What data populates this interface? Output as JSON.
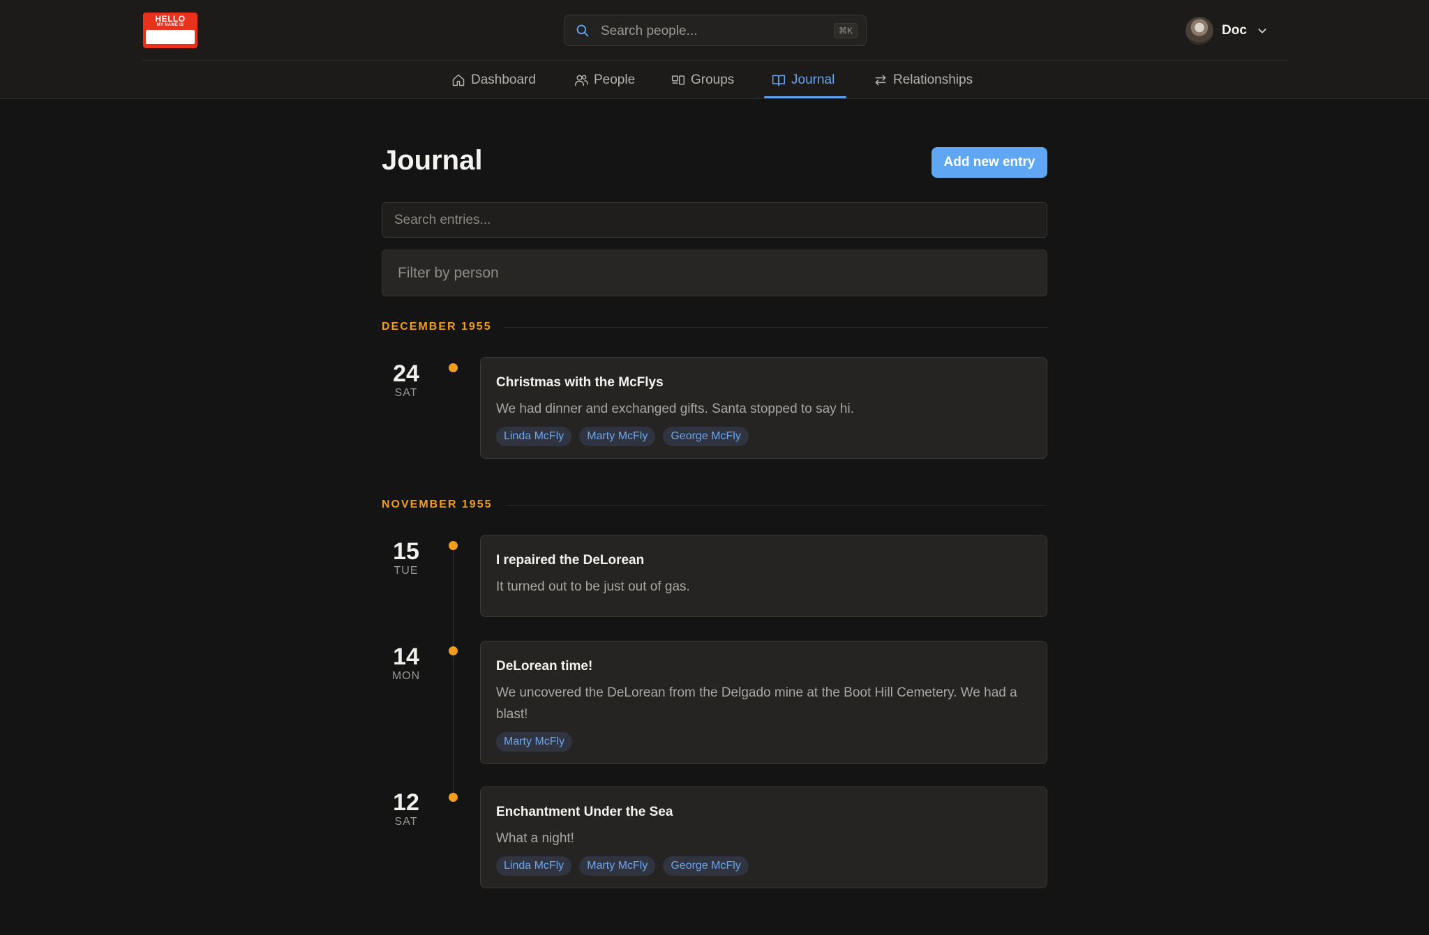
{
  "header": {
    "logo": {
      "line1": "HELLO",
      "line2": "MY NAME IS"
    },
    "search": {
      "placeholder": "Search people...",
      "shortcut": "⌘K"
    },
    "user": {
      "name": "Doc"
    }
  },
  "nav": {
    "items": [
      {
        "label": "Dashboard",
        "icon": "home-icon",
        "active": false
      },
      {
        "label": "People",
        "icon": "users-icon",
        "active": false
      },
      {
        "label": "Groups",
        "icon": "groups-icon",
        "active": false
      },
      {
        "label": "Journal",
        "icon": "book-icon",
        "active": true
      },
      {
        "label": "Relationships",
        "icon": "arrows-swap-icon",
        "active": false
      }
    ]
  },
  "page": {
    "title": "Journal",
    "add_button": "Add new entry",
    "search_placeholder": "Search entries...",
    "filter_placeholder": "Filter by person"
  },
  "months": [
    {
      "label": "DECEMBER 1955",
      "entries": [
        {
          "day": "24",
          "dow": "SAT",
          "title": "Christmas with the McFlys",
          "body": "We had dinner and exchanged gifts. Santa stopped to say hi.",
          "tags": [
            "Linda McFly",
            "Marty McFly",
            "George McFly"
          ]
        }
      ]
    },
    {
      "label": "NOVEMBER 1955",
      "entries": [
        {
          "day": "15",
          "dow": "TUE",
          "title": "I repaired the DeLorean",
          "body": "It turned out to be just out of gas.",
          "tags": []
        },
        {
          "day": "14",
          "dow": "MON",
          "title": "DeLorean time!",
          "body": "We uncovered the DeLorean from the Delgado mine at the Boot Hill Cemetery. We had a blast!",
          "tags": [
            "Marty McFly"
          ]
        },
        {
          "day": "12",
          "dow": "SAT",
          "title": "Enchantment Under the Sea",
          "body": "What a night!",
          "tags": [
            "Linda McFly",
            "Marty McFly",
            "George McFly"
          ]
        }
      ]
    }
  ],
  "colors": {
    "accent": "#5fa7f5",
    "month_label": "#f29d1e",
    "background": "#141414",
    "card": "#252422"
  }
}
